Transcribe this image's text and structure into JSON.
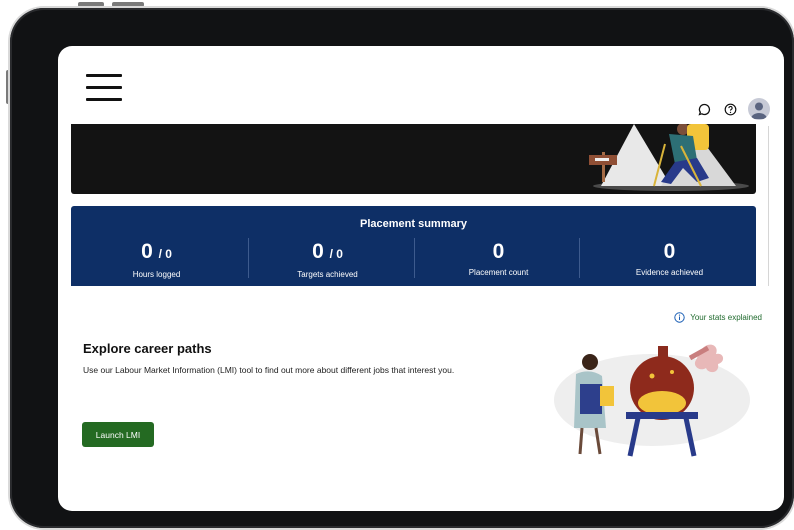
{
  "header": {
    "menu_icon": "hamburger-icon",
    "icons": [
      "chat-icon",
      "help-icon",
      "user-avatar-icon"
    ]
  },
  "summary": {
    "title": "Placement summary",
    "stats": [
      {
        "value": "0",
        "suffix": "/ 0",
        "label": "Hours logged"
      },
      {
        "value": "0",
        "suffix": "/ 0",
        "label": "Targets achieved"
      },
      {
        "value": "0",
        "suffix": "",
        "label": "Placement count"
      },
      {
        "value": "0",
        "suffix": "",
        "label": "Evidence achieved"
      }
    ],
    "bg_color": "#0e2f66"
  },
  "stats_link": {
    "icon": "info-icon",
    "label": "Your stats explained"
  },
  "explore": {
    "title": "Explore career paths",
    "description": "Use our Labour Market Information (LMI) tool to find out more about different jobs that interest you.",
    "button_label": "Launch LMI",
    "button_color": "#246a22"
  }
}
